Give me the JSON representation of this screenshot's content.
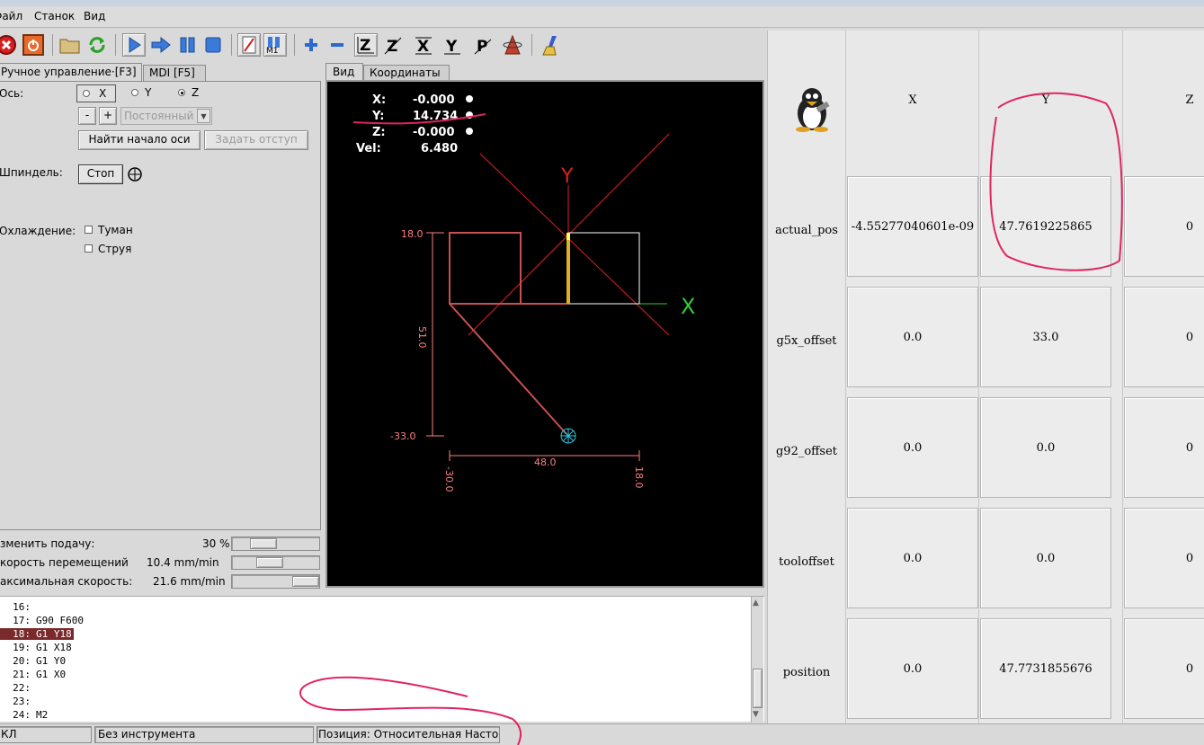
{
  "menu": {
    "file": "Файл",
    "machine": "Станок",
    "view": "Вид"
  },
  "toolbar": {
    "icons": [
      "estop-icon",
      "power-icon",
      "open-icon",
      "reload-icon",
      "run-icon",
      "step-icon",
      "pause-icon",
      "stop-icon",
      "blockdelete-icon",
      "optional-stop-icon",
      "zoom-in-icon",
      "zoom-out-icon",
      "view-z-icon",
      "view-z2-icon",
      "view-x-icon",
      "view-y-icon",
      "view-p-icon",
      "rotate-icon",
      "clear-plot-icon"
    ],
    "m1_label": "M1"
  },
  "left_tabs": {
    "manual": "Ручное управление·[F3]",
    "mdi": "MDI [F5]"
  },
  "manual": {
    "axis_label": "Ось:",
    "axis_x": "X",
    "axis_y": "Y",
    "axis_z": "Z",
    "minus": "-",
    "plus": "+",
    "jog_mode": "Постоянный",
    "home_button": "Найти начало оси",
    "touch_off_button": "Задать отступ",
    "spindle_label": "Шпиндель:",
    "spindle_stop": "Стоп",
    "coolant_label": "Охлаждение:",
    "mist": "Туман",
    "flood": "Струя"
  },
  "sliders": {
    "feed_label": "зменить подачу:",
    "feed_value": "30 %",
    "feed_level": 0.3,
    "jog_label": "корость перемещений",
    "jog_value": "10.4 mm/min",
    "jog_level": 0.4,
    "max_label": "аксимальная скорость:",
    "max_value": "21.6 mm/min",
    "max_level": 1.0
  },
  "view_tabs": {
    "view": "Вид",
    "coords": "Координаты"
  },
  "dro": [
    {
      "axis": "X:",
      "value": "-0.000"
    },
    {
      "axis": "Y:",
      "value": "14.734"
    },
    {
      "axis": "Z:",
      "value": "-0.000"
    },
    {
      "axis": "Vel:",
      "value": "6.480"
    }
  ],
  "preview": {
    "axis_y": "Y",
    "axis_x": "X",
    "dim_top": "18.0",
    "dim_mid": "51.0",
    "dim_bottom": "-33.0",
    "dim_width": "48.0",
    "dim_left": "-30.0",
    "dim_right": "18.0"
  },
  "gcode": [
    {
      "n": "16:",
      "code": ""
    },
    {
      "n": "17:",
      "code": "G90 F600"
    },
    {
      "n": "18:",
      "code": "G1 Y18"
    },
    {
      "n": "19:",
      "code": "G1 X18"
    },
    {
      "n": "20:",
      "code": "G1 Y0"
    },
    {
      "n": "21:",
      "code": "G1 X0"
    },
    {
      "n": "22:",
      "code": ""
    },
    {
      "n": "23:",
      "code": ""
    },
    {
      "n": "24:",
      "code": "M2"
    }
  ],
  "gcode_active_line": "18:",
  "status": {
    "state": "КЛ",
    "tool": "Без инструмента",
    "position": "Позиция: Относительная Насто"
  },
  "table": {
    "columns": [
      "X",
      "Y",
      "Z"
    ],
    "rows": [
      {
        "label": "actual_pos",
        "x": "-4.55277040601e-09",
        "y": "47.7619225865",
        "z": "0"
      },
      {
        "label": "g5x_offset",
        "x": "0.0",
        "y": "33.0",
        "z": "0"
      },
      {
        "label": "g92_offset",
        "x": "0.0",
        "y": "0.0",
        "z": "0"
      },
      {
        "label": "tooloffset",
        "x": "0.0",
        "y": "0.0",
        "z": "0"
      },
      {
        "label": "position",
        "x": "0.0",
        "y": "47.7731855676",
        "z": "0"
      }
    ]
  },
  "colors": {
    "annotation": "#e0245e",
    "path": "#c85050",
    "axis_green": "#33cc33",
    "highlight": "#7a2a2a"
  }
}
